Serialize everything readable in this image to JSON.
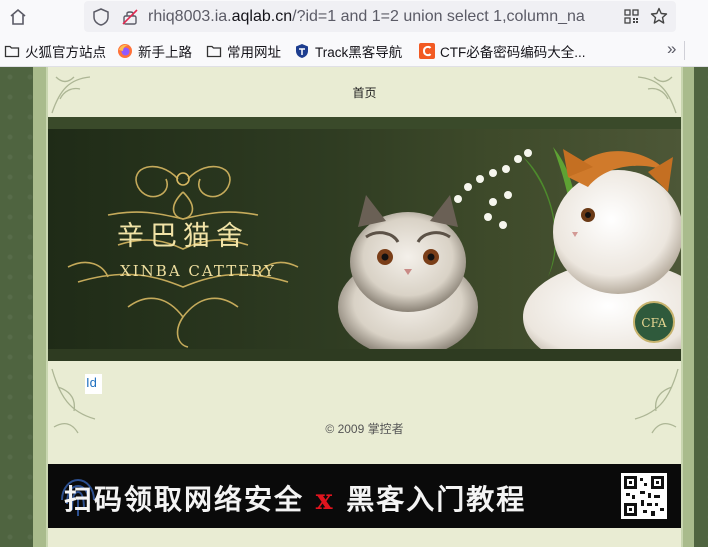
{
  "browser": {
    "url_host_prefix": "rhiq8003.ia.",
    "url_host_domain": "aqlab.cn",
    "url_path": "/?id=1 and 1=2 union select 1,column_na",
    "bookmarks": [
      {
        "label": "火狐官方站点",
        "icon": "folder-icon"
      },
      {
        "label": "新手上路",
        "icon": "firefox-icon"
      },
      {
        "label": "常用网址",
        "icon": "folder-icon"
      },
      {
        "label": "Track黑客导航",
        "icon": "shield-icon"
      },
      {
        "label": "CTF必备密码编码大全...",
        "icon": "c-logo-icon"
      }
    ],
    "more_label": "»"
  },
  "site": {
    "nav_home": "首页",
    "banner_title_cn": "辛巴猫舍",
    "banner_title_en": "XINBA CATTERY",
    "badge_text": "CFA",
    "id_link": "Id",
    "copyright": "© 2009 掌控者"
  },
  "ad": {
    "text_left": "扫码领取网络安全",
    "text_x": "x",
    "text_right": "黑客入门教程"
  },
  "colors": {
    "accent_blue": "#1e6fbf",
    "frame_green": "#a9bb8c",
    "content_bg": "#e9ecd3",
    "ad_red": "#e0141e"
  }
}
